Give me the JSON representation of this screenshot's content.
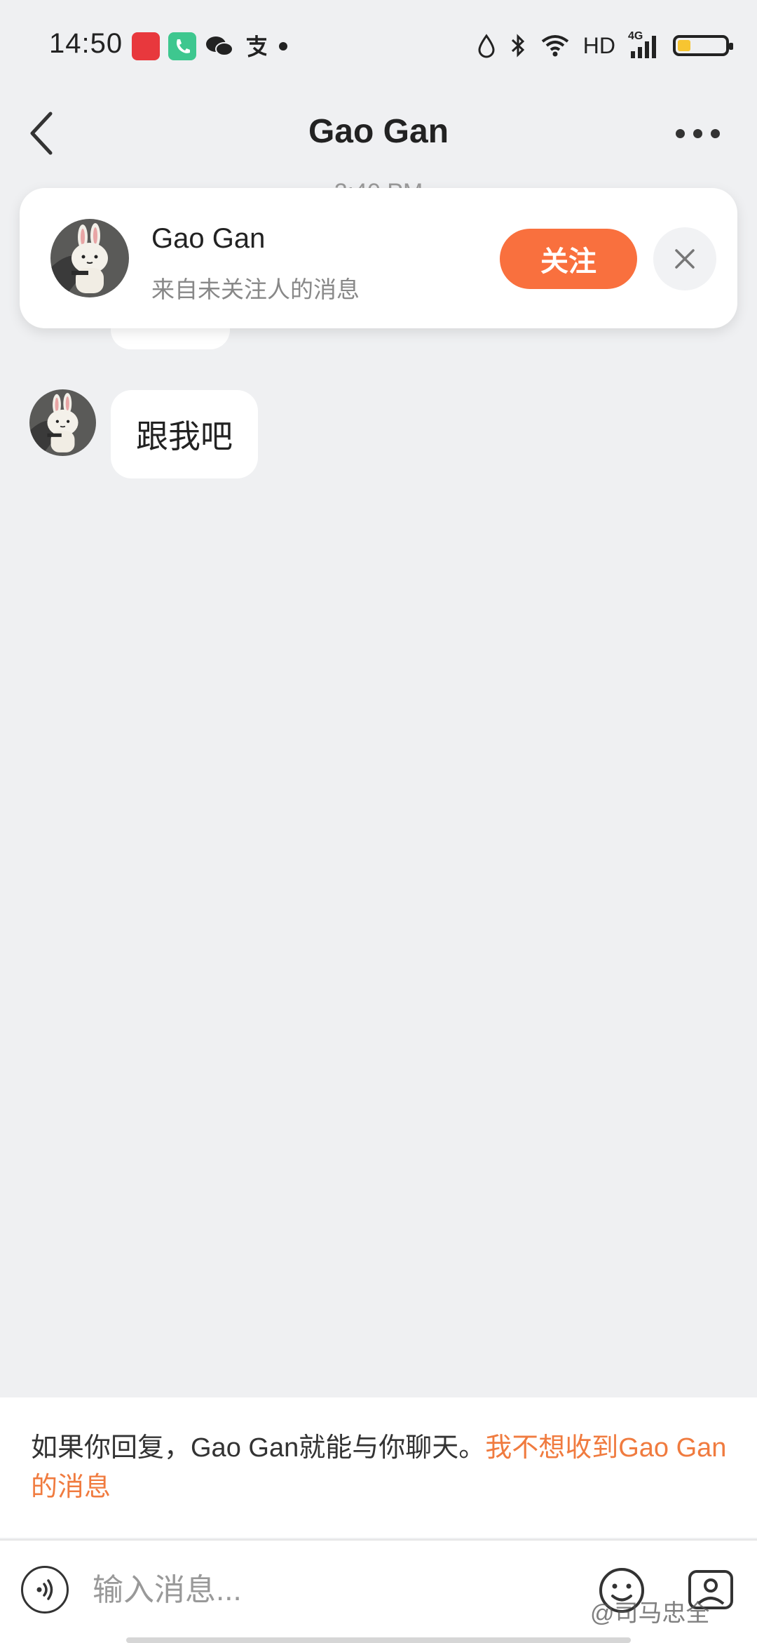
{
  "status_bar": {
    "time": "14:50",
    "network_label": "HD",
    "signal_label": "4G",
    "battery_level": 0.25,
    "notification_icons": [
      "toutiao-app-icon",
      "phone-app-icon",
      "wechat-icon",
      "alipay-icon"
    ]
  },
  "header": {
    "title": "Gao Gan"
  },
  "timestamp": "2:40 PM",
  "follow_card": {
    "name": "Gao Gan",
    "subtitle": "来自未关注人的消息",
    "follow_label": "关注"
  },
  "messages": [
    {
      "text": "跟我吧",
      "from": "Gao Gan"
    }
  ],
  "notice": {
    "text": "如果你回复，Gao Gan就能与你聊天。",
    "link": "我不想收到Gao Gan的消息"
  },
  "input": {
    "placeholder": "输入消息..."
  },
  "watermark": "@司马忠全",
  "colors": {
    "accent": "#f9703e",
    "background": "#eff0f2",
    "link": "#f07b3f"
  }
}
